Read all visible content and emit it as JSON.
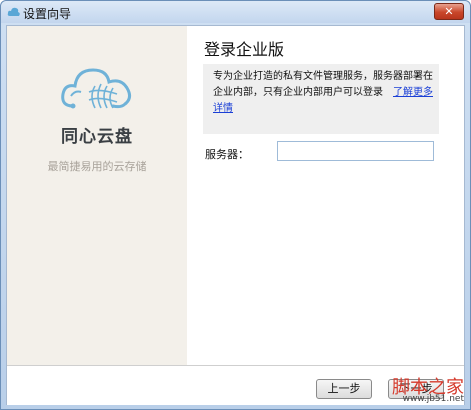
{
  "window": {
    "title": "设置向导",
    "close_label": "✕"
  },
  "left_pane": {
    "brand": "同心云盘",
    "slogan": "最简捷易用的云存储"
  },
  "main": {
    "heading": "登录企业版",
    "info_text": "专为企业打造的私有文件管理服务，服务器部署在企业内部，只有企业内部用户可以登录",
    "info_link": "了解更多详情",
    "server_label": "服务器：",
    "server_value": "",
    "server_placeholder": ""
  },
  "footer": {
    "prev_label": "上一步",
    "next_label": "下一步"
  },
  "watermark": {
    "main": "脚本之家",
    "url": "www.jb51.net"
  },
  "colors": {
    "link": "#1a3fd6",
    "logo": "#6fb2d8",
    "left_pane_bg": "#f3f0ea"
  }
}
